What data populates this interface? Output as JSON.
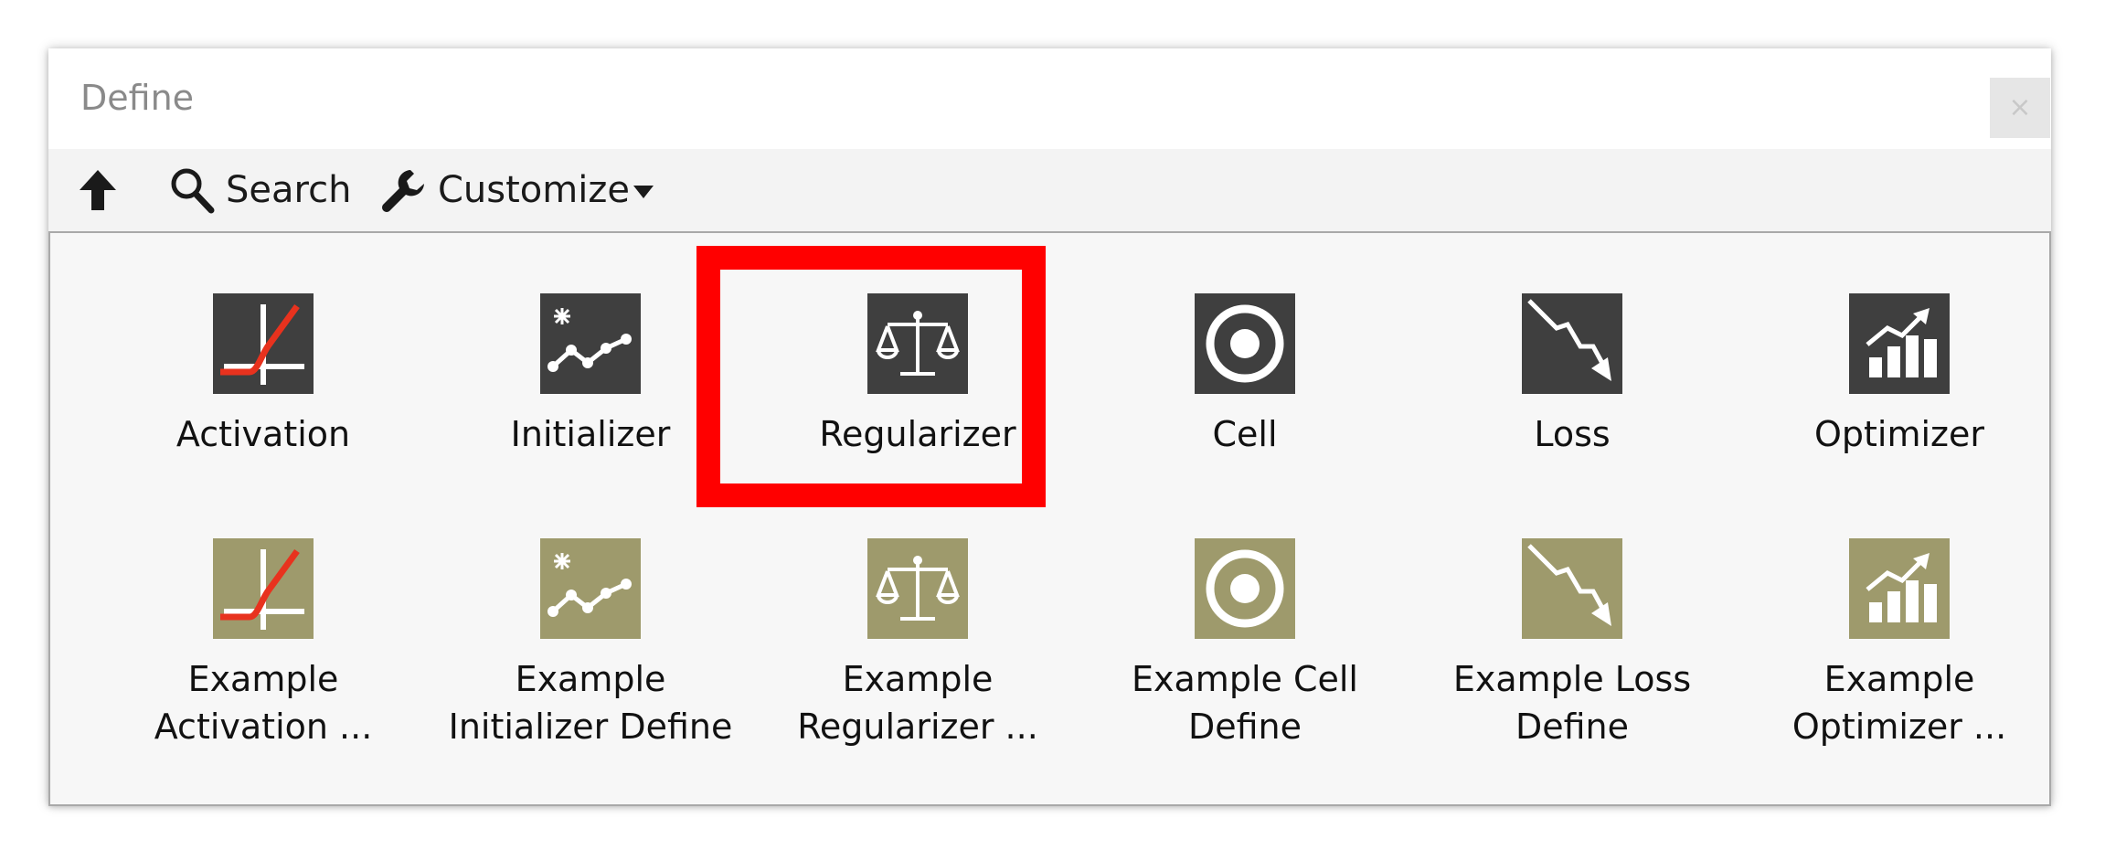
{
  "window": {
    "title": "Define",
    "close_label": "×"
  },
  "toolbar": {
    "up_icon": "arrow-up-icon",
    "search_label": "Search",
    "search_icon": "magnifier-icon",
    "customize_label": "Customize",
    "customize_icon": "wrench-icon"
  },
  "items": [
    {
      "label": "Activation",
      "icon": "activation-icon",
      "style": "dark"
    },
    {
      "label": "Initializer",
      "icon": "initializer-icon",
      "style": "dark"
    },
    {
      "label": "Regularizer",
      "icon": "scales-icon",
      "style": "dark",
      "selected": true
    },
    {
      "label": "Cell",
      "icon": "cell-icon",
      "style": "dark"
    },
    {
      "label": "Loss",
      "icon": "loss-icon",
      "style": "dark"
    },
    {
      "label": "Optimizer",
      "icon": "optimizer-icon",
      "style": "dark"
    },
    {
      "label": "Example\nActivation ...",
      "icon": "activation-icon",
      "style": "olive"
    },
    {
      "label": "Example\nInitializer Define",
      "icon": "initializer-icon",
      "style": "olive"
    },
    {
      "label": "Example\nRegularizer ...",
      "icon": "scales-icon",
      "style": "olive"
    },
    {
      "label": "Example Cell\nDefine",
      "icon": "cell-icon",
      "style": "olive"
    },
    {
      "label": "Example Loss\nDefine",
      "icon": "loss-icon",
      "style": "olive"
    },
    {
      "label": "Example\nOptimizer ...",
      "icon": "optimizer-icon",
      "style": "olive"
    }
  ],
  "colors": {
    "dark_tile": "#3f3f3f",
    "olive_tile": "#9e9a6c",
    "highlight": "#ff0000",
    "activation_curve": "#e8321e"
  }
}
